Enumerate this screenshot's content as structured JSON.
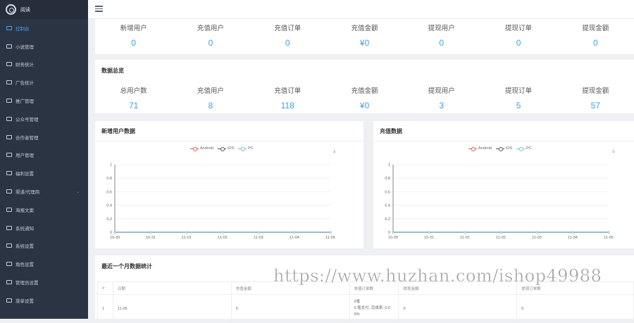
{
  "app": {
    "brand": "阅读"
  },
  "sidebar": {
    "items": [
      {
        "label": "控制台",
        "active": true,
        "icon": "home-icon"
      },
      {
        "label": "小说管理",
        "icon": "book-icon"
      },
      {
        "label": "财务统计",
        "icon": "finance-icon"
      },
      {
        "label": "广告统计",
        "icon": "ad-icon"
      },
      {
        "label": "推广管理",
        "icon": "promo-icon"
      },
      {
        "label": "公众号管理",
        "icon": "wechat-icon"
      },
      {
        "label": "合作者管理",
        "icon": "partner-icon"
      },
      {
        "label": "用户管理",
        "icon": "user-icon"
      },
      {
        "label": "福利设置",
        "icon": "gift-icon"
      },
      {
        "label": "渠道/代理商",
        "icon": "channel-icon",
        "has_arrow": true
      },
      {
        "label": "海报文案",
        "icon": "share-icon"
      },
      {
        "label": "系统通知",
        "icon": "bell-icon"
      },
      {
        "label": "系统设置",
        "icon": "gear-icon"
      },
      {
        "label": "角色设置",
        "icon": "role-icon"
      },
      {
        "label": "管理员设置",
        "icon": "admin-icon"
      },
      {
        "label": "菜单设置",
        "icon": "menu-icon"
      }
    ]
  },
  "today_stats": [
    {
      "label": "新增用户",
      "value": "0"
    },
    {
      "label": "充值用户",
      "value": "0"
    },
    {
      "label": "充值订单",
      "value": "0"
    },
    {
      "label": "充值金额",
      "value": "¥0"
    },
    {
      "label": "提现用户",
      "value": "0"
    },
    {
      "label": "提现订单",
      "value": "0"
    },
    {
      "label": "提现金额",
      "value": "0"
    }
  ],
  "overview": {
    "title": "数据总览",
    "stats": [
      {
        "label": "总用户数",
        "value": "71"
      },
      {
        "label": "充值用户",
        "value": "8"
      },
      {
        "label": "充值订单",
        "value": "118"
      },
      {
        "label": "充值金额",
        "value": "¥0"
      },
      {
        "label": "提现用户",
        "value": "3"
      },
      {
        "label": "提现订单",
        "value": "5"
      },
      {
        "label": "提现金额",
        "value": "57"
      }
    ]
  },
  "chart_data": [
    {
      "type": "line",
      "title": "新增用户数据",
      "categories": [
        "10-30",
        "10-31",
        "11-01",
        "11-02",
        "11-03",
        "11-04",
        "11-05"
      ],
      "series": [
        {
          "name": "Android",
          "values": [
            0,
            0,
            0,
            0,
            0,
            0,
            0
          ],
          "color": "#e05a4f"
        },
        {
          "name": "iOS",
          "values": [
            0,
            0,
            0,
            0,
            0,
            0,
            0
          ],
          "color": "#4a5562"
        },
        {
          "name": "PC",
          "values": [
            0,
            0,
            0,
            0,
            0,
            0,
            0
          ],
          "color": "#7cc3c7"
        }
      ],
      "ylim": [
        0,
        1
      ],
      "yticks": [
        "0",
        "0.2",
        "0.4",
        "0.6",
        "0.8",
        "1"
      ],
      "grid": true,
      "legend": "top"
    },
    {
      "type": "line",
      "title": "充值数据",
      "categories": [
        "10-30",
        "10-31",
        "11-01",
        "11-02",
        "11-03",
        "11-04",
        "11-05"
      ],
      "series": [
        {
          "name": "Android",
          "values": [
            0,
            0,
            0,
            0,
            0,
            0,
            0
          ],
          "color": "#e05a4f"
        },
        {
          "name": "iOS",
          "values": [
            0,
            0,
            0,
            0,
            0,
            0,
            0
          ],
          "color": "#4a5562"
        },
        {
          "name": "PC",
          "values": [
            0,
            0,
            0,
            0,
            0,
            0,
            0
          ],
          "color": "#7cc3c7"
        }
      ],
      "ylim": [
        0,
        1
      ],
      "yticks": [
        "0",
        "0.2",
        "0.4",
        "0.6",
        "0.8",
        "1"
      ],
      "grid": true,
      "legend": "top"
    }
  ],
  "monthly": {
    "title": "最近一个月数据统计",
    "columns": [
      "#",
      "日期",
      "充值金额",
      "充值订单数",
      "提现金额",
      "提现订单数"
    ],
    "rows": [
      {
        "index": "1",
        "date": "11-05",
        "amount": "0",
        "orders_lines": [
          "0笔",
          "0 笔支付, 完成率: 0.0",
          "0%"
        ],
        "withdraw_amount": "0",
        "withdraw_orders": "0"
      }
    ]
  },
  "watermark": "https://www.huzhan.com/ishop49988"
}
